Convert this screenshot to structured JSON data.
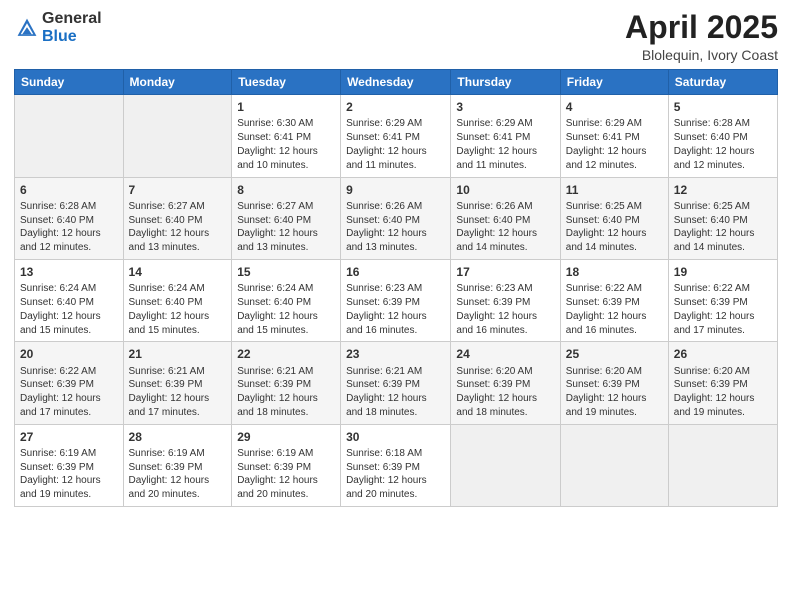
{
  "header": {
    "logo_general": "General",
    "logo_blue": "Blue",
    "title": "April 2025",
    "subtitle": "Blolequin, Ivory Coast"
  },
  "weekdays": [
    "Sunday",
    "Monday",
    "Tuesday",
    "Wednesday",
    "Thursday",
    "Friday",
    "Saturday"
  ],
  "rows": [
    [
      {
        "day": "",
        "info": ""
      },
      {
        "day": "",
        "info": ""
      },
      {
        "day": "1",
        "info": "Sunrise: 6:30 AM\nSunset: 6:41 PM\nDaylight: 12 hours and 10 minutes."
      },
      {
        "day": "2",
        "info": "Sunrise: 6:29 AM\nSunset: 6:41 PM\nDaylight: 12 hours and 11 minutes."
      },
      {
        "day": "3",
        "info": "Sunrise: 6:29 AM\nSunset: 6:41 PM\nDaylight: 12 hours and 11 minutes."
      },
      {
        "day": "4",
        "info": "Sunrise: 6:29 AM\nSunset: 6:41 PM\nDaylight: 12 hours and 12 minutes."
      },
      {
        "day": "5",
        "info": "Sunrise: 6:28 AM\nSunset: 6:40 PM\nDaylight: 12 hours and 12 minutes."
      }
    ],
    [
      {
        "day": "6",
        "info": "Sunrise: 6:28 AM\nSunset: 6:40 PM\nDaylight: 12 hours and 12 minutes."
      },
      {
        "day": "7",
        "info": "Sunrise: 6:27 AM\nSunset: 6:40 PM\nDaylight: 12 hours and 13 minutes."
      },
      {
        "day": "8",
        "info": "Sunrise: 6:27 AM\nSunset: 6:40 PM\nDaylight: 12 hours and 13 minutes."
      },
      {
        "day": "9",
        "info": "Sunrise: 6:26 AM\nSunset: 6:40 PM\nDaylight: 12 hours and 13 minutes."
      },
      {
        "day": "10",
        "info": "Sunrise: 6:26 AM\nSunset: 6:40 PM\nDaylight: 12 hours and 14 minutes."
      },
      {
        "day": "11",
        "info": "Sunrise: 6:25 AM\nSunset: 6:40 PM\nDaylight: 12 hours and 14 minutes."
      },
      {
        "day": "12",
        "info": "Sunrise: 6:25 AM\nSunset: 6:40 PM\nDaylight: 12 hours and 14 minutes."
      }
    ],
    [
      {
        "day": "13",
        "info": "Sunrise: 6:24 AM\nSunset: 6:40 PM\nDaylight: 12 hours and 15 minutes."
      },
      {
        "day": "14",
        "info": "Sunrise: 6:24 AM\nSunset: 6:40 PM\nDaylight: 12 hours and 15 minutes."
      },
      {
        "day": "15",
        "info": "Sunrise: 6:24 AM\nSunset: 6:40 PM\nDaylight: 12 hours and 15 minutes."
      },
      {
        "day": "16",
        "info": "Sunrise: 6:23 AM\nSunset: 6:39 PM\nDaylight: 12 hours and 16 minutes."
      },
      {
        "day": "17",
        "info": "Sunrise: 6:23 AM\nSunset: 6:39 PM\nDaylight: 12 hours and 16 minutes."
      },
      {
        "day": "18",
        "info": "Sunrise: 6:22 AM\nSunset: 6:39 PM\nDaylight: 12 hours and 16 minutes."
      },
      {
        "day": "19",
        "info": "Sunrise: 6:22 AM\nSunset: 6:39 PM\nDaylight: 12 hours and 17 minutes."
      }
    ],
    [
      {
        "day": "20",
        "info": "Sunrise: 6:22 AM\nSunset: 6:39 PM\nDaylight: 12 hours and 17 minutes."
      },
      {
        "day": "21",
        "info": "Sunrise: 6:21 AM\nSunset: 6:39 PM\nDaylight: 12 hours and 17 minutes."
      },
      {
        "day": "22",
        "info": "Sunrise: 6:21 AM\nSunset: 6:39 PM\nDaylight: 12 hours and 18 minutes."
      },
      {
        "day": "23",
        "info": "Sunrise: 6:21 AM\nSunset: 6:39 PM\nDaylight: 12 hours and 18 minutes."
      },
      {
        "day": "24",
        "info": "Sunrise: 6:20 AM\nSunset: 6:39 PM\nDaylight: 12 hours and 18 minutes."
      },
      {
        "day": "25",
        "info": "Sunrise: 6:20 AM\nSunset: 6:39 PM\nDaylight: 12 hours and 19 minutes."
      },
      {
        "day": "26",
        "info": "Sunrise: 6:20 AM\nSunset: 6:39 PM\nDaylight: 12 hours and 19 minutes."
      }
    ],
    [
      {
        "day": "27",
        "info": "Sunrise: 6:19 AM\nSunset: 6:39 PM\nDaylight: 12 hours and 19 minutes."
      },
      {
        "day": "28",
        "info": "Sunrise: 6:19 AM\nSunset: 6:39 PM\nDaylight: 12 hours and 20 minutes."
      },
      {
        "day": "29",
        "info": "Sunrise: 6:19 AM\nSunset: 6:39 PM\nDaylight: 12 hours and 20 minutes."
      },
      {
        "day": "30",
        "info": "Sunrise: 6:18 AM\nSunset: 6:39 PM\nDaylight: 12 hours and 20 minutes."
      },
      {
        "day": "",
        "info": ""
      },
      {
        "day": "",
        "info": ""
      },
      {
        "day": "",
        "info": ""
      }
    ]
  ]
}
